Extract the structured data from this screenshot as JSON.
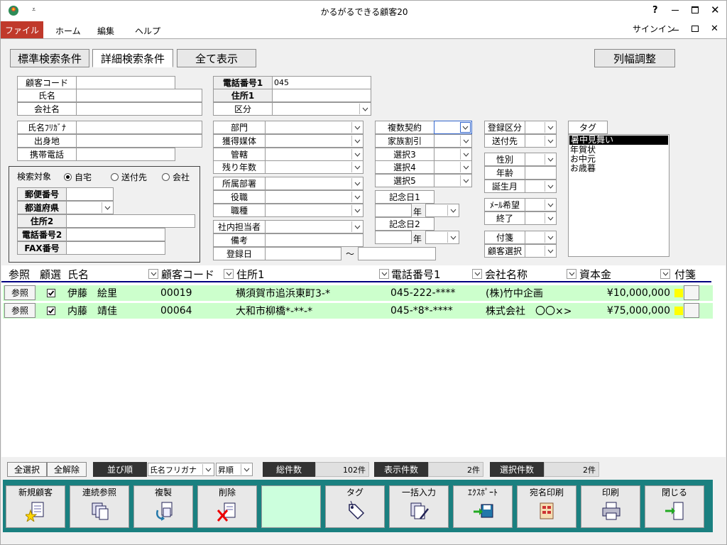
{
  "window": {
    "title": "かるがるできる顧客20",
    "help": "?",
    "signin": "サインイン"
  },
  "ribbon": {
    "file": "ファイル",
    "home": "ホーム",
    "edit": "編集",
    "help": "ヘルプ"
  },
  "tabs": {
    "standard": "標準検索条件",
    "detail": "詳細検索条件",
    "show_all": "全て表示",
    "col_width": "列幅調整"
  },
  "form": {
    "customer_code": "顧客コード",
    "name": "氏名",
    "company": "会社名",
    "name_kana": "氏名ﾌﾘｶﾞﾅ",
    "birthplace": "出身地",
    "mobile": "携帯電話",
    "search_target": "検索対象",
    "target_home": "自宅",
    "target_dest": "送付先",
    "target_company": "会社",
    "postal": "郵便番号",
    "pref": "都道府県",
    "addr2": "住所2",
    "phone2": "電話番号2",
    "fax": "FAX番号",
    "phone1": "電話番号1",
    "phone1_value": "045",
    "addr1": "住所1",
    "category": "区分",
    "dept": "部門",
    "media": "獲得媒体",
    "jurisdiction": "管轄",
    "years_left": "残り年数",
    "affiliation": "所属部署",
    "position": "役職",
    "job": "職種",
    "staff": "社内担当者",
    "remarks": "備考",
    "reg_date": "登録日",
    "tilde": "～",
    "multi_contract": "複数契約",
    "family_discount": "家族割引",
    "sel3": "選択3",
    "sel4": "選択4",
    "sel5": "選択5",
    "anniv1": "記念日1",
    "anniv2": "記念日2",
    "year": "年",
    "reg_cat": "登録区分",
    "send_dest": "送付先",
    "gender": "性別",
    "age": "年齢",
    "birth_month": "誕生月",
    "mail_wish": "ﾒｰﾙ希望",
    "end": "終了",
    "tag_note": "付箋",
    "cust_select": "顧客選択",
    "tag": "タグ",
    "tag_items": [
      "暑中見舞い",
      "年賀状",
      "お中元",
      "お歳暮"
    ]
  },
  "grid": {
    "headers": {
      "ref": "参照",
      "select": "顧選",
      "name": "氏名",
      "code": "顧客コード",
      "addr": "住所1",
      "phone": "電話番号1",
      "company": "会社名称",
      "capital": "資本金",
      "tag": "付箋"
    },
    "rows": [
      {
        "ref": "参照",
        "name": "伊藤　絵里",
        "code": "00019",
        "addr": "横須賀市追浜東町3-*",
        "phone": "045-222-****",
        "company": "(株)竹中企画",
        "capital": "¥10,000,000"
      },
      {
        "ref": "参照",
        "name": "内藤　靖佳",
        "code": "00064",
        "addr": "大和市柳橋*-**-*",
        "phone": "045-*8*-****",
        "company": "株式会社　〇〇×>",
        "capital": "¥75,000,000"
      }
    ]
  },
  "status": {
    "select_all": "全選択",
    "deselect_all": "全解除",
    "sort_label": "並び順",
    "sort_field": "氏名フリガナ",
    "sort_dir": "昇順",
    "total_label": "総件数",
    "total_value": "102件",
    "shown_label": "表示件数",
    "shown_value": "2件",
    "selected_label": "選択件数",
    "selected_value": "2件"
  },
  "buttons": {
    "new": "新規顧客",
    "multi_ref": "連続参照",
    "copy": "複製",
    "delete": "削除",
    "tag": "タグ",
    "bulk": "一括入力",
    "export": "ｴｸｽﾎﾟｰﾄ",
    "label_print": "宛名印刷",
    "print": "印刷",
    "close": "閉じる"
  },
  "colors": {
    "file_tab": "#c0392b",
    "row_green": "#ccffcc",
    "toolbar": "#1a8080",
    "header_line": "#000080"
  }
}
